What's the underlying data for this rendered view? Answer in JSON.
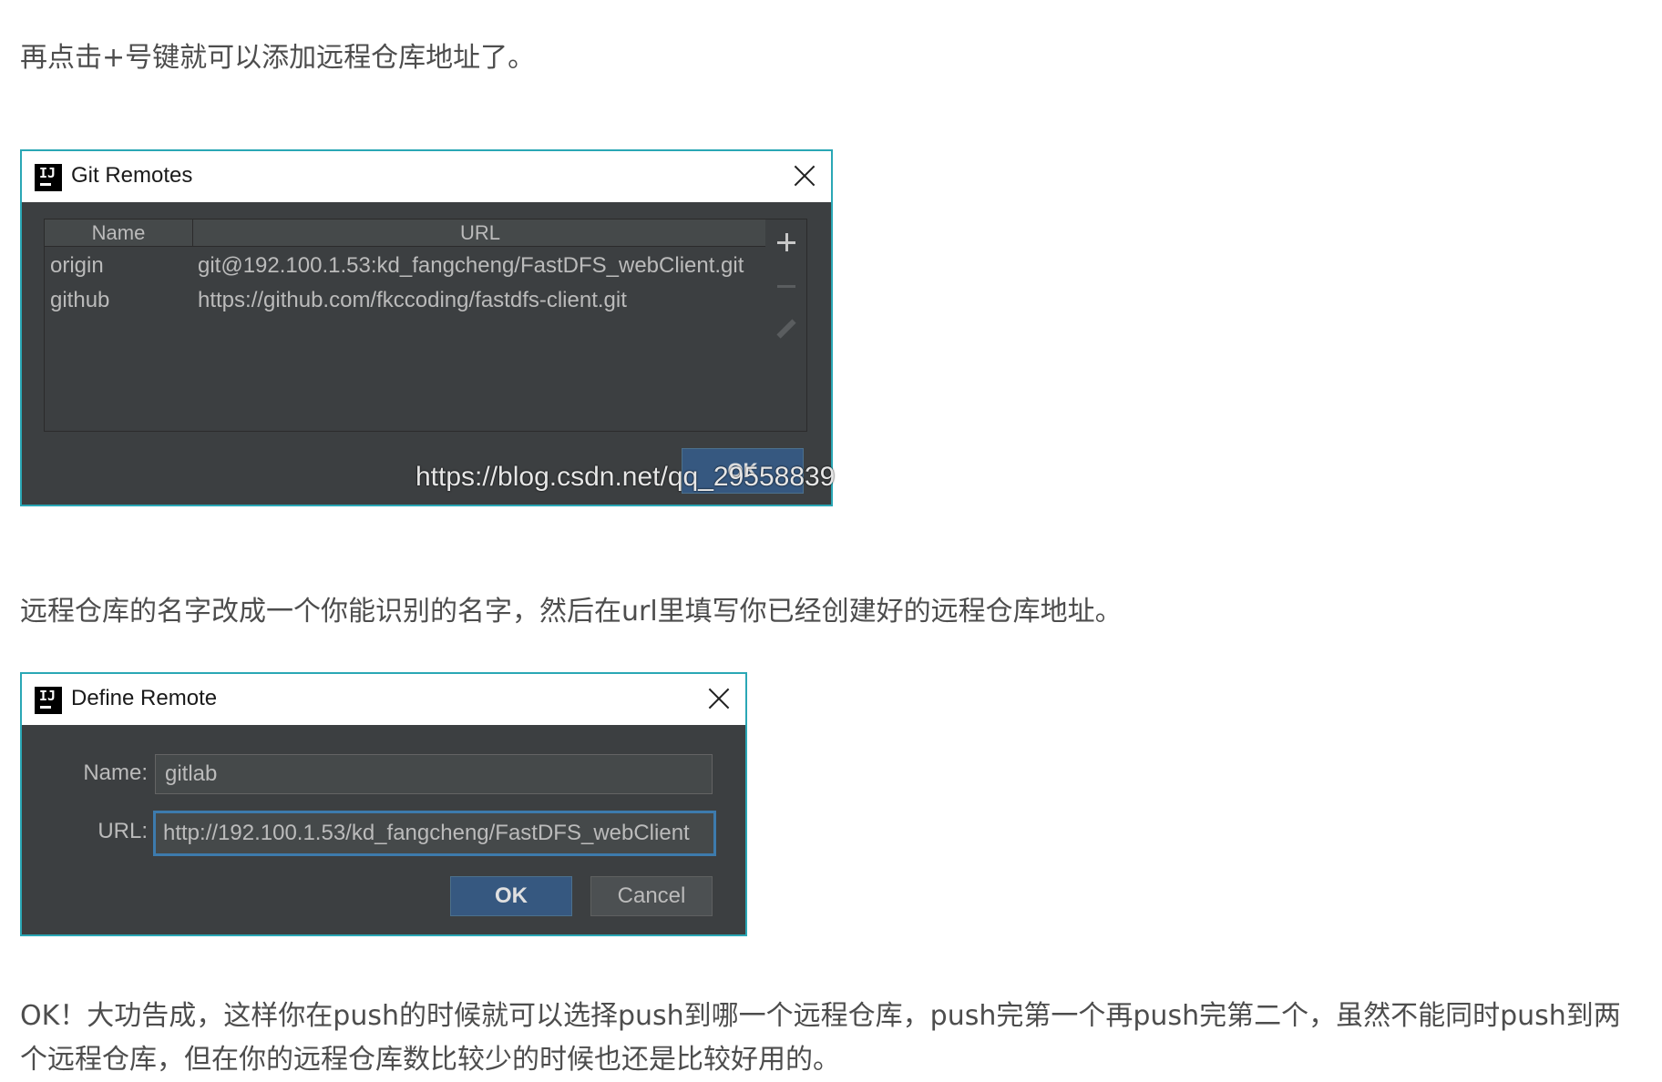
{
  "paragraphs": {
    "p1": "再点击+号键就可以添加远程仓库地址了。",
    "p2": "远程仓库的名字改成一个你能识别的名字，然后在url里填写你已经创建好的远程仓库地址。",
    "p3": "OK！大功告成，这样你在push的时候就可以选择push到哪一个远程仓库，push完第一个再push完第二个，虽然不能同时push到两个远程仓库，但在你的远程仓库数比较少的时候也还是比较好用的。"
  },
  "git_remotes": {
    "title": "Git Remotes",
    "columns": [
      "Name",
      "URL"
    ],
    "rows": [
      {
        "name": "origin",
        "url": "git@192.100.1.53:kd_fangcheng/FastDFS_webClient.git"
      },
      {
        "name": "github",
        "url": "https://github.com/fkccoding/fastdfs-client.git"
      }
    ],
    "ok_label": "OK",
    "watermark": "https://blog.csdn.net/qq_29558839"
  },
  "define_remote": {
    "title": "Define Remote",
    "name_label": "Name:",
    "name_value": "gitlab",
    "url_label": "URL:",
    "url_value": "http://192.100.1.53/kd_fangcheng/FastDFS_webClient",
    "ok_label": "OK",
    "cancel_label": "Cancel"
  },
  "colors": {
    "dialog_border": "#2aa7b5",
    "dialog_bg": "#3c3f41",
    "primary_button": "#365880",
    "focus_border": "#3d7bad"
  }
}
